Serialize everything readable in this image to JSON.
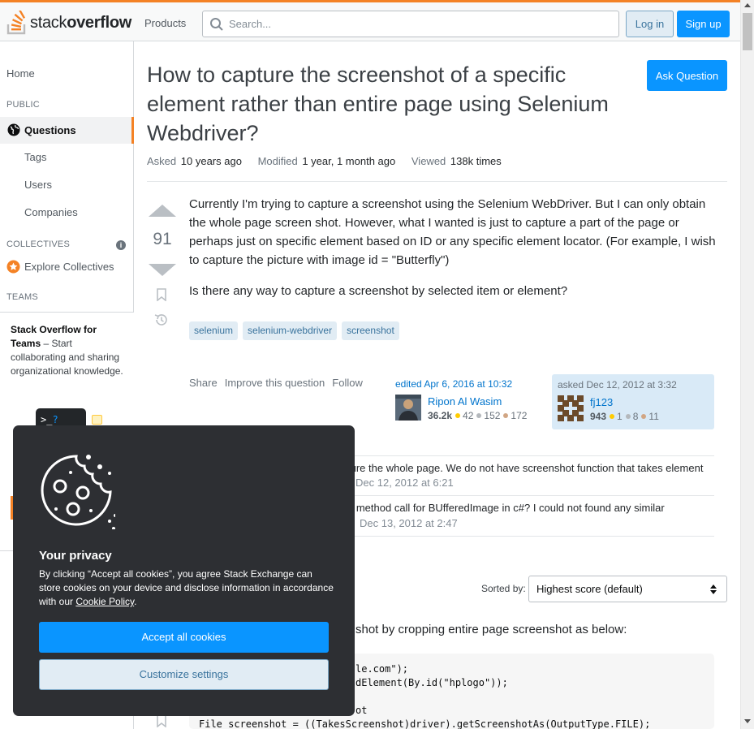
{
  "header": {
    "logo_light": "stack",
    "logo_bold": "overflow",
    "products_label": "Products",
    "search_placeholder": "Search...",
    "login_label": "Log in",
    "signup_label": "Sign up"
  },
  "sidebar": {
    "home": "Home",
    "public_heading": "PUBLIC",
    "questions": "Questions",
    "tags": "Tags",
    "users": "Users",
    "companies": "Companies",
    "collectives_heading": "COLLECTIVES",
    "explore_collectives": "Explore Collectives",
    "teams_heading": "TEAMS",
    "teams_title": "Stack Overflow for Teams",
    "teams_text": " – Start collaborating and sharing organizational knowledge.",
    "teams_prompt": ">_",
    "teams_prompt_q": "?"
  },
  "question": {
    "title": "How to capture the screenshot of a specific element rather than entire page using Selenium Webdriver?",
    "ask_button": "Ask Question",
    "asked_label": "Asked",
    "asked_value": "10 years ago",
    "modified_label": "Modified",
    "modified_value": "1 year, 1 month ago",
    "viewed_label": "Viewed",
    "viewed_value": "138k times",
    "votes": "91",
    "body_p1": "Currently I'm trying to capture a screenshot using the Selenium WebDriver. But I can only obtain the whole page screen shot. However, what I wanted is just to capture a part of the page or perhaps just on specific element based on ID or any specific element locator. (For example, I wish to capture the picture with image id = \"Butterfly\")",
    "body_p2": "Is there any way to capture a screenshot by selected item or element?",
    "tags": [
      "selenium",
      "selenium-webdriver",
      "screenshot"
    ],
    "menu": [
      "Share",
      "Improve this question",
      "Follow"
    ]
  },
  "editor": {
    "label": "edited Apr 6, 2016 at 10:32",
    "name": "Ripon Al Wasim",
    "rep": "36.2k",
    "gold": "42",
    "silver": "152",
    "bronze": "172"
  },
  "asker": {
    "label": "asked Dec 12, 2012 at 3:32",
    "name": "fj123",
    "rep": "943",
    "gold": "1",
    "silver": "8",
    "bronze": "11"
  },
  "comments": [
    {
      "text": "ture the whole page. We do not have screenshot function that takes element",
      "date": "Dec 12, 2012 at 6:21"
    },
    {
      "text": "e method call for BUfferedImage in c#? I could not found any similar",
      "date": "Dec 13, 2012 at 2:47"
    }
  ],
  "answers": {
    "sorted_label": "Sorted by:",
    "sort_value": "Highest score (default)",
    "answer_text": "shot by cropping entire page screenshot as below:",
    "code_lines": [
      "le.com\");",
      "dElement(By.id(\"hplogo\"));",
      "",
      "ot",
      "File screenshot = ((TakesScreenshot)driver).getScreenshotAs(OutputType.FILE);"
    ]
  },
  "cookie": {
    "title": "Your privacy",
    "body_before": "By clicking “Accept all cookies”, you agree Stack Exchange can store cookies on your device and disclose information in accordance with our ",
    "policy_link": "Cookie Policy",
    "body_after": ".",
    "accept": "Accept all cookies",
    "customize": "Customize settings"
  },
  "colors": {
    "accent": "#f48225",
    "primary": "#0a95ff",
    "link": "#0074cc",
    "gold": "#ffcc01",
    "silver": "#b4b8bc",
    "bronze": "#d1a684"
  },
  "icons": [
    "stack-overflow-logo-icon",
    "search-icon",
    "globe-icon",
    "info-icon",
    "collectives-star-icon",
    "vote-up-icon",
    "vote-down-icon",
    "bookmark-icon",
    "history-icon",
    "cookie-icon",
    "sort-arrows-icon"
  ]
}
